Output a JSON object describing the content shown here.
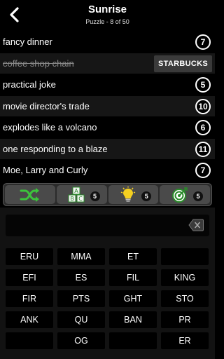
{
  "header": {
    "title": "Sunrise",
    "subtitle": "Puzzle - 8 of 50"
  },
  "clues": [
    {
      "text": "fancy dinner",
      "count": "7",
      "solved": false
    },
    {
      "text": "coffee shop chain",
      "answer": "STARBUCKS",
      "solved": true
    },
    {
      "text": "practical joke",
      "count": "5",
      "solved": false
    },
    {
      "text": "movie director's trade",
      "count": "10",
      "solved": false
    },
    {
      "text": "explodes like a volcano",
      "count": "6",
      "solved": false
    },
    {
      "text": "one responding to a blaze",
      "count": "11",
      "solved": false
    },
    {
      "text": "Moe, Larry and Curly",
      "count": "7",
      "solved": false
    }
  ],
  "toolbar": {
    "shuffle_icon": "shuffle-icon",
    "letters_badge": "5",
    "hint_badge": "5",
    "solve_badge": "5"
  },
  "input": {
    "value": ""
  },
  "tiles": [
    [
      "ERU",
      "MMA",
      "ET",
      ""
    ],
    [
      "EFI",
      "ES",
      "FIL",
      "KING"
    ],
    [
      "FIR",
      "PTS",
      "GHT",
      "STO"
    ],
    [
      "ANK",
      "QU",
      "BAN",
      "PR"
    ],
    [
      "",
      "OG",
      "",
      "ER"
    ]
  ],
  "colors": {
    "accent_green": "#3cc43c",
    "background": "#000000",
    "panel": "#121212"
  }
}
